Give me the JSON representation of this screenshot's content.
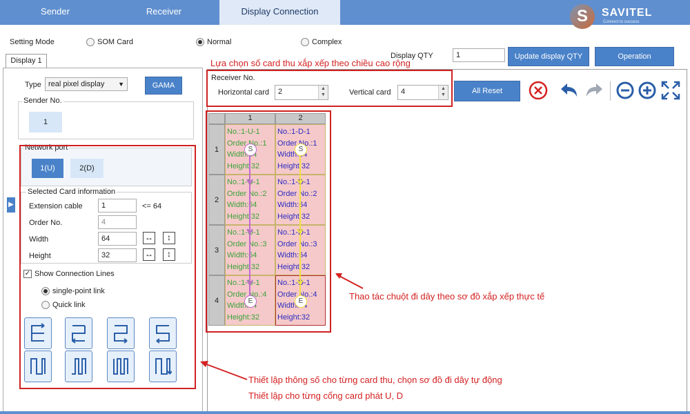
{
  "tabs": [
    {
      "label": "Sender",
      "active": false
    },
    {
      "label": "Receiver",
      "active": false
    },
    {
      "label": "Display Connection",
      "active": true
    }
  ],
  "logo": {
    "letter": "S",
    "name": "SAVITEL",
    "tagline": "Connect to success"
  },
  "setting_mode": {
    "label": "Setting Mode",
    "options": [
      {
        "label": "SOM Card",
        "selected": false
      },
      {
        "label": "Normal",
        "selected": true
      },
      {
        "label": "Complex",
        "selected": false
      }
    ]
  },
  "display_tab": "Display 1",
  "display_qty": {
    "label": "Display QTY",
    "value": "1"
  },
  "buttons": {
    "update": "Update display QTY",
    "operation": "Operation",
    "gama": "GAMA",
    "all_reset": "All Reset"
  },
  "type": {
    "label": "Type",
    "value": "real pixel display"
  },
  "sender_no": {
    "label": "Sender No.",
    "value": "1"
  },
  "network_port": {
    "label": "Network port",
    "ports": [
      "1(U)",
      "2(D)"
    ]
  },
  "selected_card": {
    "title": "Selected Card information",
    "extension_cable": {
      "label": "Extension cable",
      "value": "1",
      "hint": "<= 64"
    },
    "order_no": {
      "label": "Order No.",
      "value": "4"
    },
    "width": {
      "label": "Width",
      "value": "64"
    },
    "height": {
      "label": "Height",
      "value": "32"
    }
  },
  "show_lines": {
    "label": "Show Connection Lines",
    "checked": true
  },
  "link_options": [
    {
      "label": "single-point link",
      "selected": true
    },
    {
      "label": "Quick link",
      "selected": false
    }
  ],
  "receiver_no": {
    "label": "Receiver No.",
    "horizontal": {
      "label": "Horizontal card",
      "value": "2"
    },
    "vertical": {
      "label": "Vertical card",
      "value": "4"
    }
  },
  "grid": {
    "col_headers": [
      "1",
      "2"
    ],
    "row_headers": [
      "1",
      "2",
      "3",
      "4"
    ],
    "cells": [
      [
        [
          "No.:1-U-1",
          "Order No.:1",
          "Width:64",
          "Height:32"
        ],
        [
          "No.:1-D-1",
          "Order No.:1",
          "Width:64",
          "Height:32"
        ]
      ],
      [
        [
          "No.:1-U-1",
          "Order No.:2",
          "Width:64",
          "Height:32"
        ],
        [
          "No.:1-D-1",
          "Order No.:2",
          "Width:64",
          "Height:32"
        ]
      ],
      [
        [
          "No.:1-U-1",
          "Order No.:3",
          "Width:64",
          "Height:32"
        ],
        [
          "No.:1-D-1",
          "Order No.:3",
          "Width:64",
          "Height:32"
        ]
      ],
      [
        [
          "No.:1-U-1",
          "Order No.:4",
          "Width:64",
          "Height:32"
        ],
        [
          "No.:1-D-1",
          "Order No.:4",
          "Width:64",
          "Height:32"
        ]
      ]
    ],
    "start_marker": "S",
    "end_marker": "E"
  },
  "annotations": {
    "top": "Lựa chọn số card thu xắp xếp theo chiều cao rộng",
    "right": "Thao tác chuột đi dây theo sơ đồ xắp xếp thực tế",
    "bottom1": "Thiết lập thông số cho từng card thu, chọn sơ đồ đi dây tự động",
    "bottom2": "Thiết lập cho từng cổng card phát U, D"
  },
  "colors": {
    "accent": "#4a82c9",
    "annotation_red": "#d42020"
  }
}
